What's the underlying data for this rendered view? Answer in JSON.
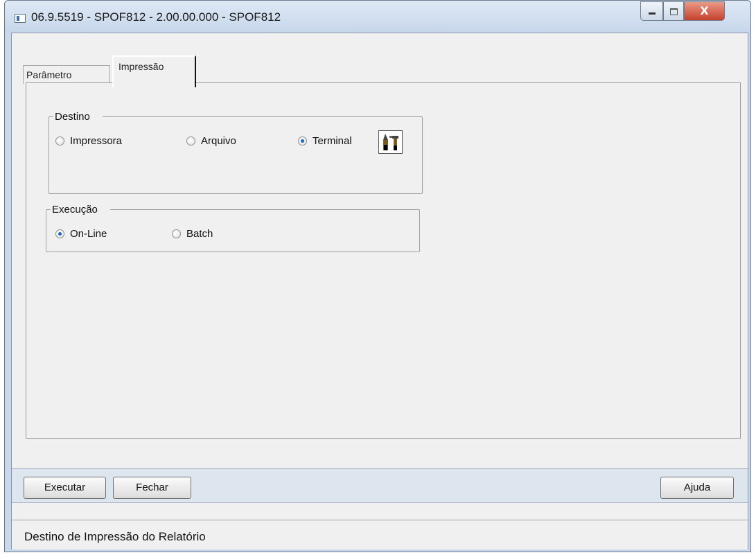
{
  "window": {
    "title": "06.9.5519 - SPOF812 - 2.00.00.000 - SPOF812",
    "close_glyph": "X"
  },
  "tabs": [
    {
      "label": "Parâmetro",
      "active": false
    },
    {
      "label": "Impressão",
      "active": true
    }
  ],
  "destino": {
    "legend": "Destino",
    "options": [
      {
        "label": "Impressora",
        "selected": false
      },
      {
        "label": "Arquivo",
        "selected": false
      },
      {
        "label": "Terminal",
        "selected": true
      }
    ],
    "config_icon": "tools-icon"
  },
  "execucao": {
    "legend": "Execução",
    "options": [
      {
        "label": "On-Line",
        "selected": true
      },
      {
        "label": "Batch",
        "selected": false
      }
    ]
  },
  "buttons": {
    "execute": "Executar",
    "close": "Fechar",
    "help": "Ajuda"
  },
  "status": "Destino de Impressão do Relatório",
  "colors": {
    "frame": "#c9d8ea",
    "client": "#f0f0f0",
    "button_bar": "#dde5ef",
    "radio_selected": "#1f64c4",
    "close_button": "#c5402c"
  }
}
